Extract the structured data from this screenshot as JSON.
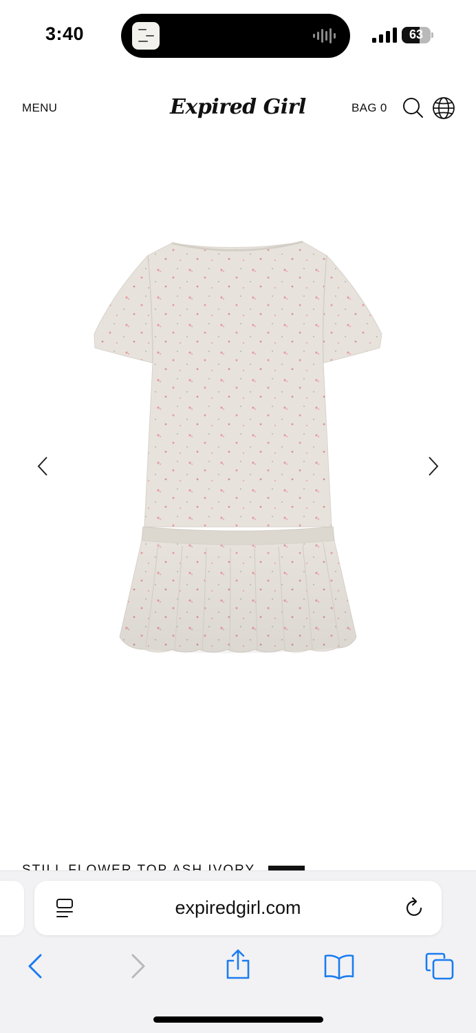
{
  "status_bar": {
    "time": "3:40",
    "battery_level": "63",
    "battery_fraction": 0.63,
    "signal_bars": 4
  },
  "header": {
    "menu_label": "MENU",
    "logo_text": "Expired Girl",
    "bag_label": "BAG 0",
    "icons": {
      "search": "search-icon",
      "language": "globe-icon"
    }
  },
  "gallery": {
    "image": "product-image",
    "prev_icon": "chevron-left-icon",
    "next_icon": "chevron-right-icon",
    "product_title_partial": "STILL FLOWER TOP ASH IVORY"
  },
  "safari": {
    "url": "expiredgirl.com",
    "icons": {
      "reader": "reader-icon",
      "reload": "reload-icon",
      "back": "back-icon",
      "forward": "forward-icon",
      "share": "share-icon",
      "bookmarks": "bookmarks-icon",
      "tabs": "tabs-icon"
    },
    "colors": {
      "accent": "#1a7cf0",
      "disabled": "#b8b8bd"
    }
  }
}
